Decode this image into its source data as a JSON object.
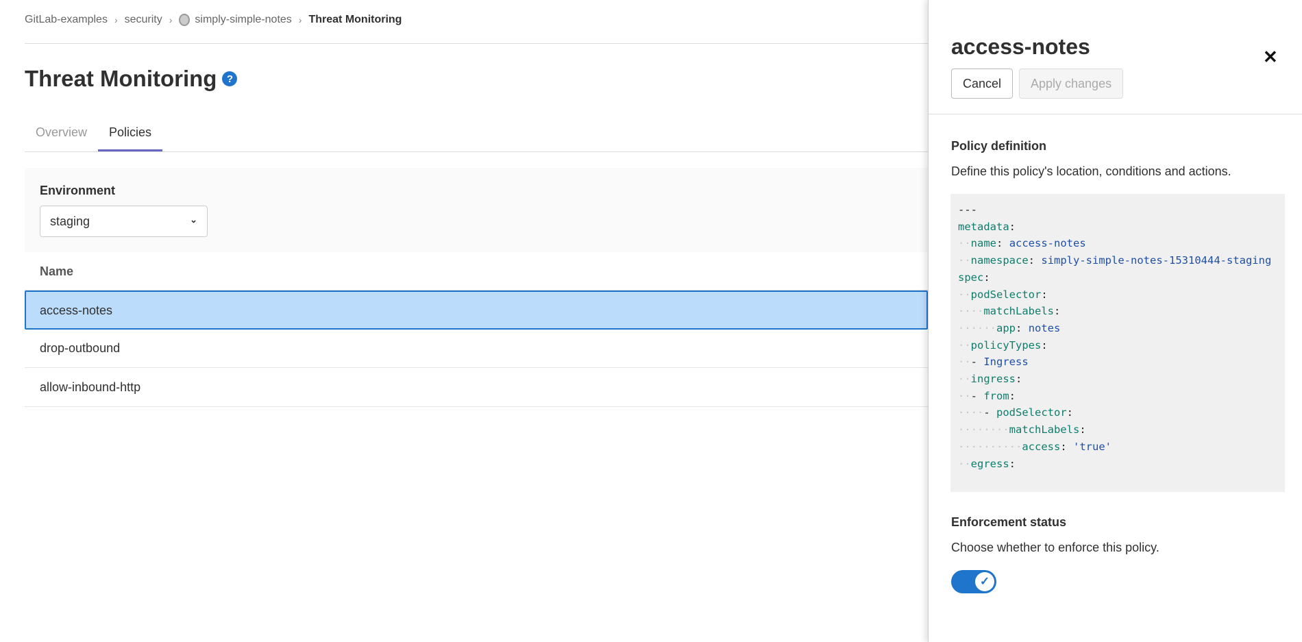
{
  "breadcrumb": [
    "GitLab-examples",
    "security",
    "simply-simple-notes",
    "Threat Monitoring"
  ],
  "page_title": "Threat Monitoring",
  "tabs": [
    {
      "label": "Overview",
      "active": false
    },
    {
      "label": "Policies",
      "active": true
    }
  ],
  "filter": {
    "label": "Environment",
    "selected": "staging"
  },
  "table": {
    "header": "Name",
    "rows": [
      "access-notes",
      "drop-outbound",
      "allow-inbound-http"
    ],
    "selected": "access-notes"
  },
  "drawer": {
    "title": "access-notes",
    "cancel": "Cancel",
    "apply": "Apply changes",
    "definition_heading": "Policy definition",
    "definition_desc": "Define this policy's location, conditions and actions.",
    "yaml": [
      {
        "indent": 0,
        "key": "---",
        "value": ""
      },
      {
        "indent": 0,
        "key": "metadata",
        "value": ""
      },
      {
        "indent": 2,
        "key": "name",
        "value": "access-notes"
      },
      {
        "indent": 2,
        "key": "namespace",
        "value": "simply-simple-notes-15310444-staging"
      },
      {
        "indent": 0,
        "key": "spec",
        "value": ""
      },
      {
        "indent": 2,
        "key": "podSelector",
        "value": ""
      },
      {
        "indent": 4,
        "key": "matchLabels",
        "value": ""
      },
      {
        "indent": 6,
        "key": "app",
        "value": "notes"
      },
      {
        "indent": 2,
        "key": "policyTypes",
        "value": ""
      },
      {
        "indent": 2,
        "dash": true,
        "key": "",
        "value": "Ingress"
      },
      {
        "indent": 2,
        "key": "ingress",
        "value": ""
      },
      {
        "indent": 2,
        "dash": true,
        "key": "from",
        "value": ""
      },
      {
        "indent": 4,
        "dash": true,
        "key": "podSelector",
        "value": ""
      },
      {
        "indent": 8,
        "key": "matchLabels",
        "value": ""
      },
      {
        "indent": 10,
        "key": "access",
        "value": "'true'"
      },
      {
        "indent": 2,
        "key": "egress",
        "value": ""
      }
    ],
    "enforcement_heading": "Enforcement status",
    "enforcement_desc": "Choose whether to enforce this policy.",
    "enforced": true
  },
  "colors": {
    "accent": "#1f75cb",
    "selected_row": "#bcdcfb",
    "tab_underline": "#6666c4"
  }
}
